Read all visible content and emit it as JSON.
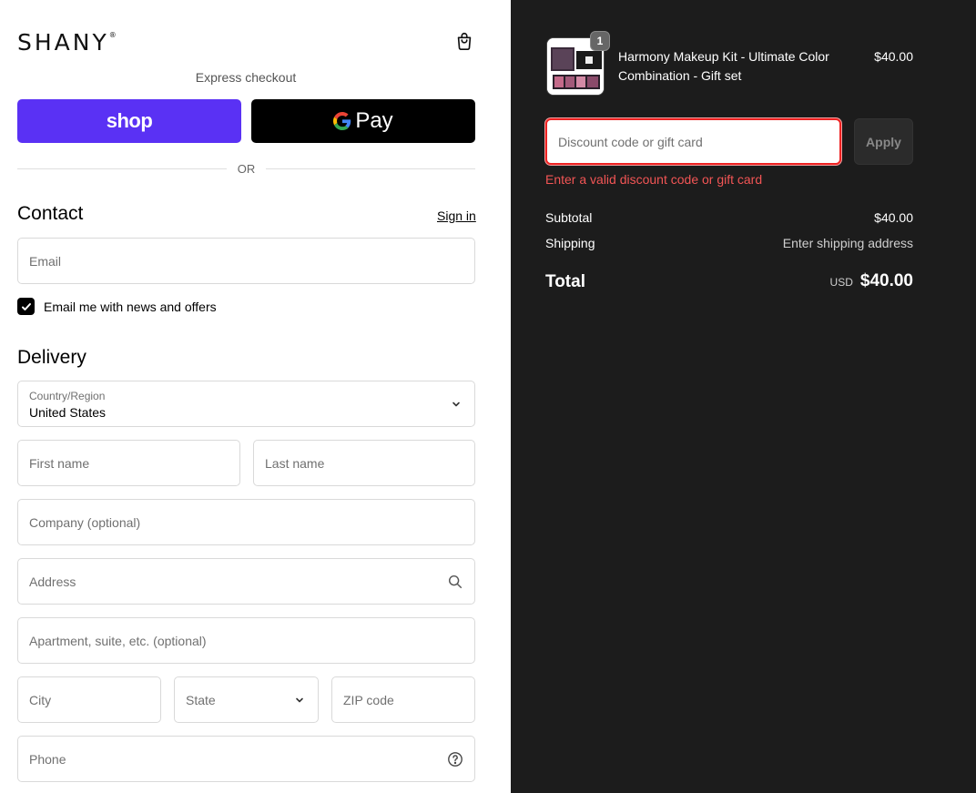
{
  "brand": {
    "logo_text": "SHANY",
    "logo_mark": "®"
  },
  "express": {
    "title": "Express checkout",
    "shop_label": "shop",
    "gpay_label": "Pay",
    "or_label": "OR"
  },
  "contact": {
    "title": "Contact",
    "signin_label": "Sign in",
    "email_placeholder": "Email",
    "newsletter_label": "Email me with news and offers",
    "newsletter_checked": true
  },
  "delivery": {
    "title": "Delivery",
    "country_label": "Country/Region",
    "country_value": "United States",
    "first_name_placeholder": "First name",
    "last_name_placeholder": "Last name",
    "company_placeholder": "Company (optional)",
    "address_placeholder": "Address",
    "apartment_placeholder": "Apartment, suite, etc. (optional)",
    "city_placeholder": "City",
    "state_placeholder": "State",
    "zip_placeholder": "ZIP code",
    "phone_placeholder": "Phone"
  },
  "summary": {
    "product_name": "Harmony Makeup Kit - Ultimate Color Combination - Gift set",
    "product_price": "$40.00",
    "quantity": "1",
    "discount_placeholder": "Discount code or gift card",
    "apply_label": "Apply",
    "discount_error": "Enter a valid discount code or gift card",
    "subtotal_label": "Subtotal",
    "subtotal_value": "$40.00",
    "shipping_label": "Shipping",
    "shipping_value": "Enter shipping address",
    "total_label": "Total",
    "total_currency": "USD",
    "total_value": "$40.00"
  },
  "colors": {
    "shop_purple": "#5a31f4",
    "error_red": "#f25555",
    "summary_bg": "#1c1c1c"
  },
  "icons": {
    "cart": "shopping-bag-icon",
    "search": "search-icon",
    "help": "question-circle-icon",
    "chevron": "chevron-down-icon",
    "check": "check-icon"
  }
}
